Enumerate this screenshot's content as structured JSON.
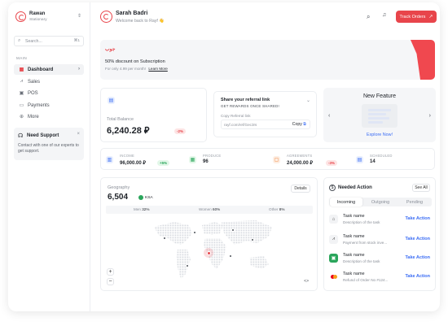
{
  "sidebar": {
    "brand_name": "Rawan",
    "brand_sub": "Stationary",
    "search_placeholder": "Search...",
    "search_shortcut": "⌘1",
    "section_label": "MAIN",
    "items": [
      {
        "label": "Dashboard",
        "icon": "grid-icon",
        "active": true
      },
      {
        "label": "Sales",
        "icon": "chart-icon",
        "active": false
      },
      {
        "label": "POS",
        "icon": "pos-icon",
        "active": false
      },
      {
        "label": "Payments",
        "icon": "card-icon",
        "active": false
      },
      {
        "label": "More",
        "icon": "more-icon",
        "active": false
      }
    ],
    "support": {
      "title": "Need Support",
      "text": "Contact with one of our experts to get support."
    }
  },
  "header": {
    "user_name": "Sarah Badri",
    "welcome": "Welcome back to Rayf 👋",
    "track_orders_label": "Track Orders"
  },
  "promo": {
    "brand_text": "جوب",
    "headline": "50% discount on Subscription",
    "subtext": "For only 4.99 per month!",
    "link": "Learn More"
  },
  "balance": {
    "label": "Total Balance",
    "value": "6,240.28 ⃁",
    "change": "-2%"
  },
  "referral": {
    "title": "Share your referral link",
    "subtitle": "GET REWARDS ONCE SHARED!",
    "copy_label": "Copy Referral link",
    "link": "rayf.com/ref/Gec3rs",
    "copy_button": "Copy"
  },
  "feature": {
    "title": "New Feature",
    "link": "Explore Now!"
  },
  "stats": [
    {
      "label": "INCOME",
      "value": "96,000.00 ⃁",
      "badge": "+5%",
      "badge_type": "green",
      "icon_color": "#3a6cf4"
    },
    {
      "label": "PRODUCE",
      "value": "96",
      "badge": "",
      "badge_type": "",
      "icon_color": "#2aa55b"
    },
    {
      "label": "AGREEMENTS",
      "value": "24,000.00 ⃁",
      "badge": "-3%",
      "badge_type": "red",
      "icon_color": "#f07a2e"
    },
    {
      "label": "SCHEDULED",
      "value": "14",
      "badge": "",
      "badge_type": "",
      "icon_color": "#3a6cf4"
    }
  ],
  "geography": {
    "title": "Geography",
    "value": "6,504",
    "country": "KSA",
    "details_label": "Details",
    "segments": [
      {
        "label": "Men",
        "value": "32%"
      },
      {
        "label": "Women",
        "value": "60%"
      },
      {
        "label": "Other",
        "value": "8%"
      }
    ],
    "zoom_in": "+",
    "zoom_out": "−",
    "embed": "<>"
  },
  "needed_action": {
    "title": "Needed Action",
    "see_all": "See All",
    "tabs": [
      "Incoming",
      "Outgoing",
      "Pending"
    ],
    "active_tab": 0,
    "tasks": [
      {
        "title": "Task name",
        "desc": "Description of the task",
        "action": "Take Action",
        "icon": "bank-icon"
      },
      {
        "title": "Task name",
        "desc": "Payment from stock inve...",
        "action": "Take Action",
        "icon": "trend-icon"
      },
      {
        "title": "Task name",
        "desc": "Description of the task",
        "action": "Take Action",
        "icon": "store-icon"
      },
      {
        "title": "Task name",
        "desc": "Refund of Order No #124...",
        "action": "Take Action",
        "icon": "mastercard-icon"
      }
    ]
  },
  "colors": {
    "accent": "#e8454b",
    "link": "#3a6cf4"
  }
}
